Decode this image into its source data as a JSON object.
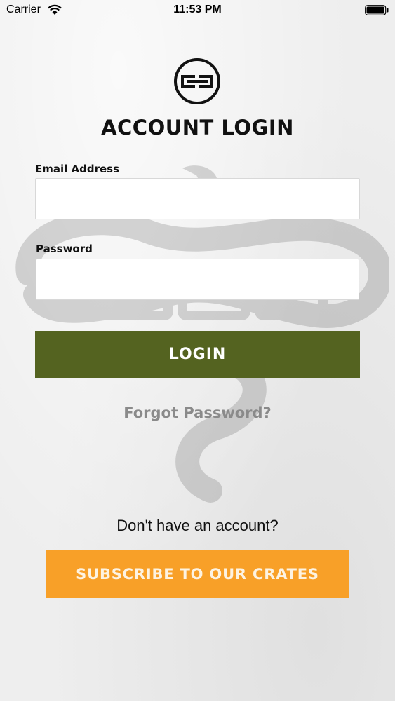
{
  "status_bar": {
    "carrier": "Carrier",
    "time": "11:53 PM",
    "wifi_icon": "wifi-icon",
    "battery_icon": "battery-icon"
  },
  "header": {
    "logo_icon": "brand-logo-icon",
    "title": "ACCOUNT LOGIN"
  },
  "form": {
    "email_label": "Email Address",
    "email_value": "",
    "email_placeholder": "",
    "password_label": "Password",
    "password_value": "",
    "password_placeholder": "",
    "login_label": "LOGIN",
    "forgot_label": "Forgot Password?"
  },
  "footer": {
    "prompt": "Don't have an account?",
    "subscribe_label": "SUBSCRIBE TO OUR CRATES"
  },
  "colors": {
    "login_button": "#546320",
    "subscribe_button": "#f8a028",
    "forgot_text": "#8a8a8a"
  }
}
